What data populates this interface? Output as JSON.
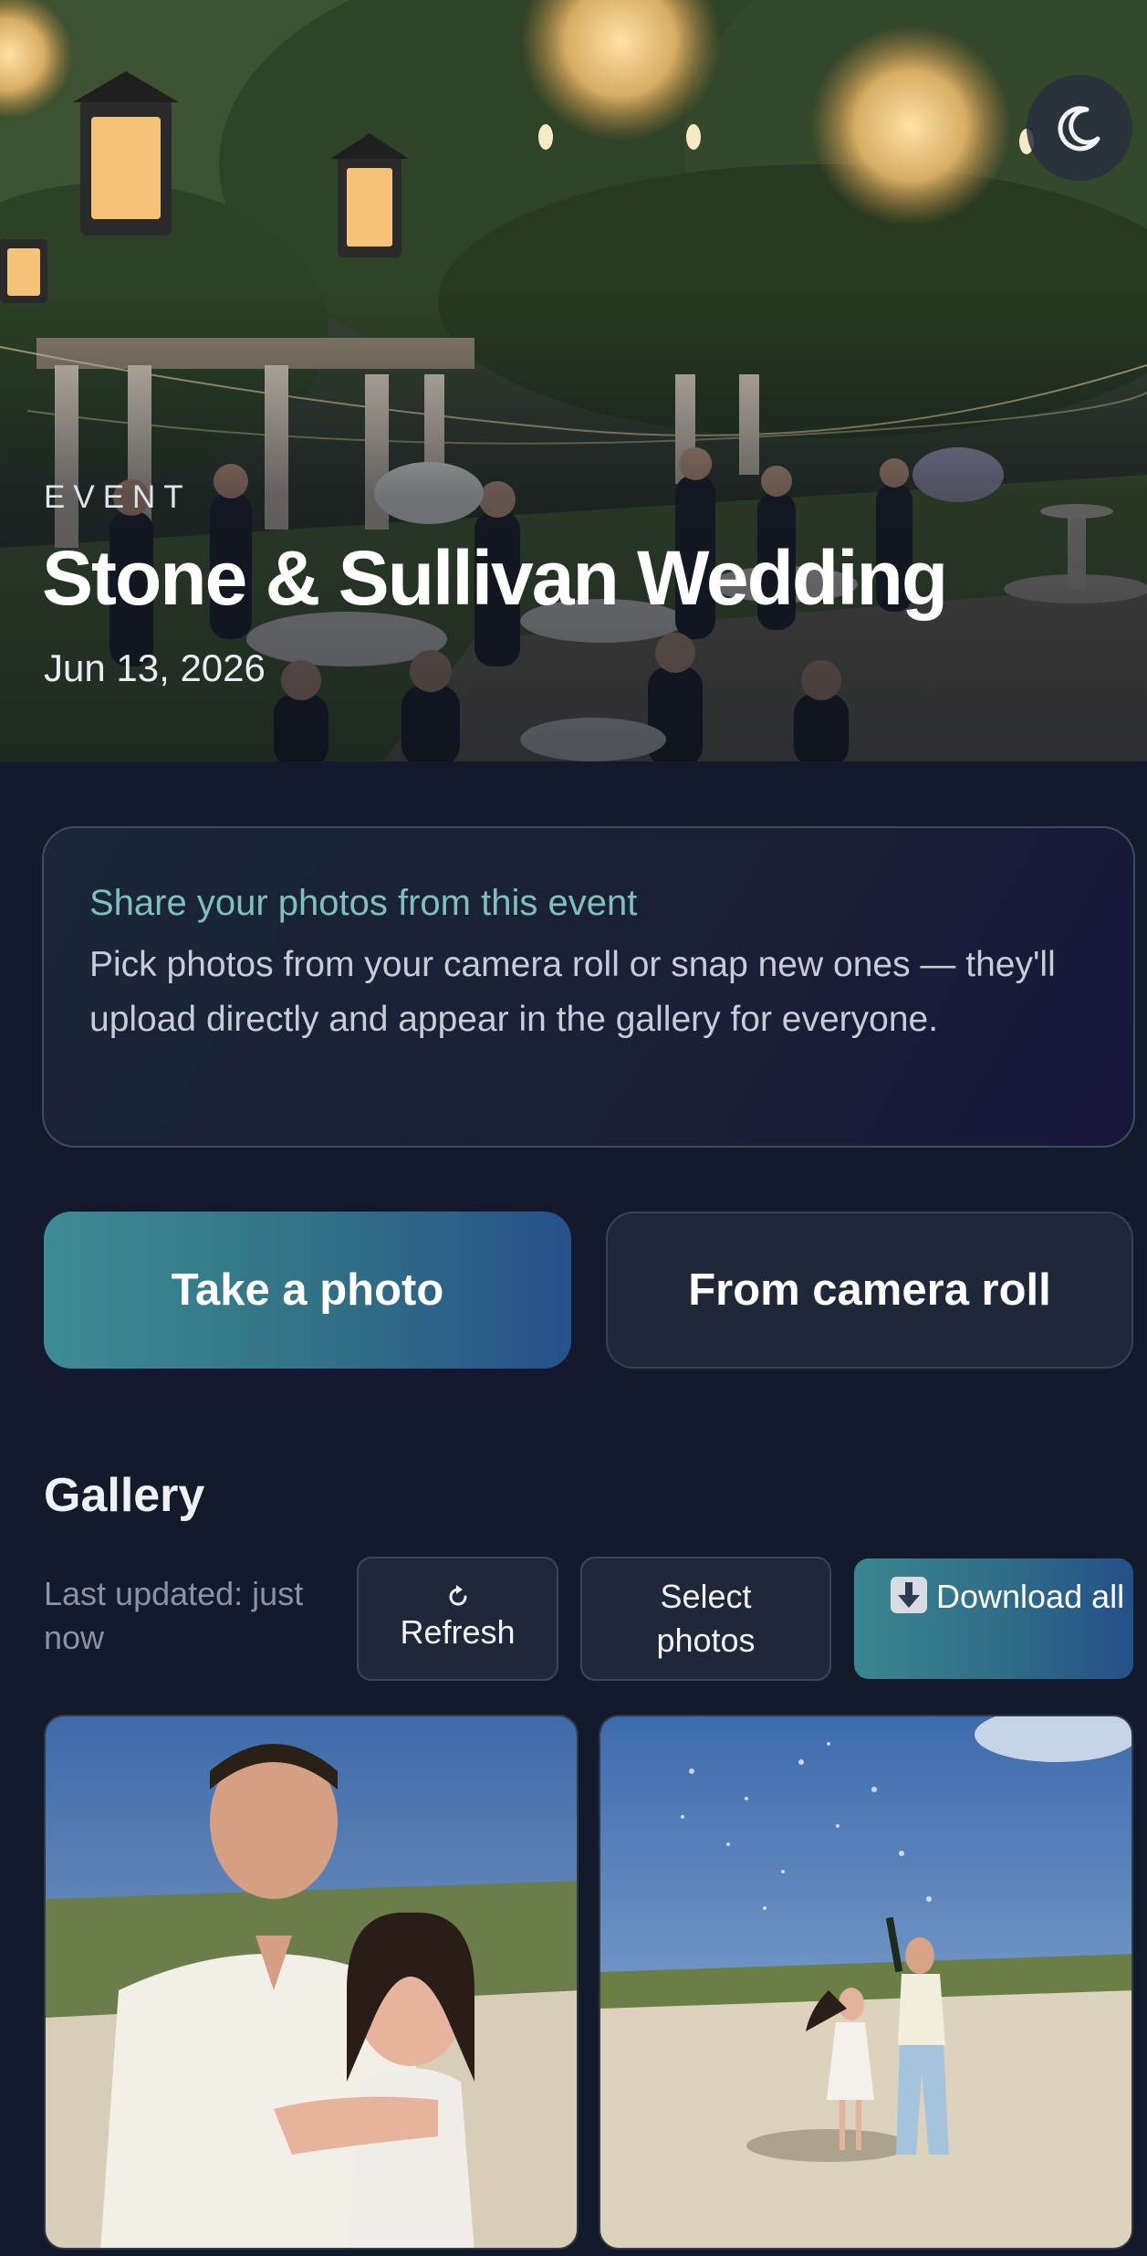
{
  "hero": {
    "eyebrow": "EVENT",
    "title": "Stone & Sullivan Wedding",
    "date": "Jun 13, 2026",
    "theme_toggle_icon": "moon-icon"
  },
  "share_card": {
    "title": "Share your photos from this event",
    "body": "Pick photos from your camera roll or snap new ones — they'll upload directly and appear in the gallery for everyone."
  },
  "actions": {
    "take_photo": "Take a photo",
    "camera_roll": "From camera roll"
  },
  "gallery": {
    "heading": "Gallery",
    "last_updated": "Last updated: just now",
    "refresh_icon": "refresh-icon",
    "refresh_label": "Refresh",
    "select_label": "Select photos",
    "download_icon": "download-icon",
    "download_label": "Download all",
    "photos": [
      {
        "subject": "couple-ring-photo"
      },
      {
        "subject": "beach-champagne-photo"
      }
    ]
  },
  "colors": {
    "background": "#131a2a",
    "accent_teal": "#3d8b95",
    "accent_blue": "#26518a",
    "share_title": "#7fc0bb"
  }
}
